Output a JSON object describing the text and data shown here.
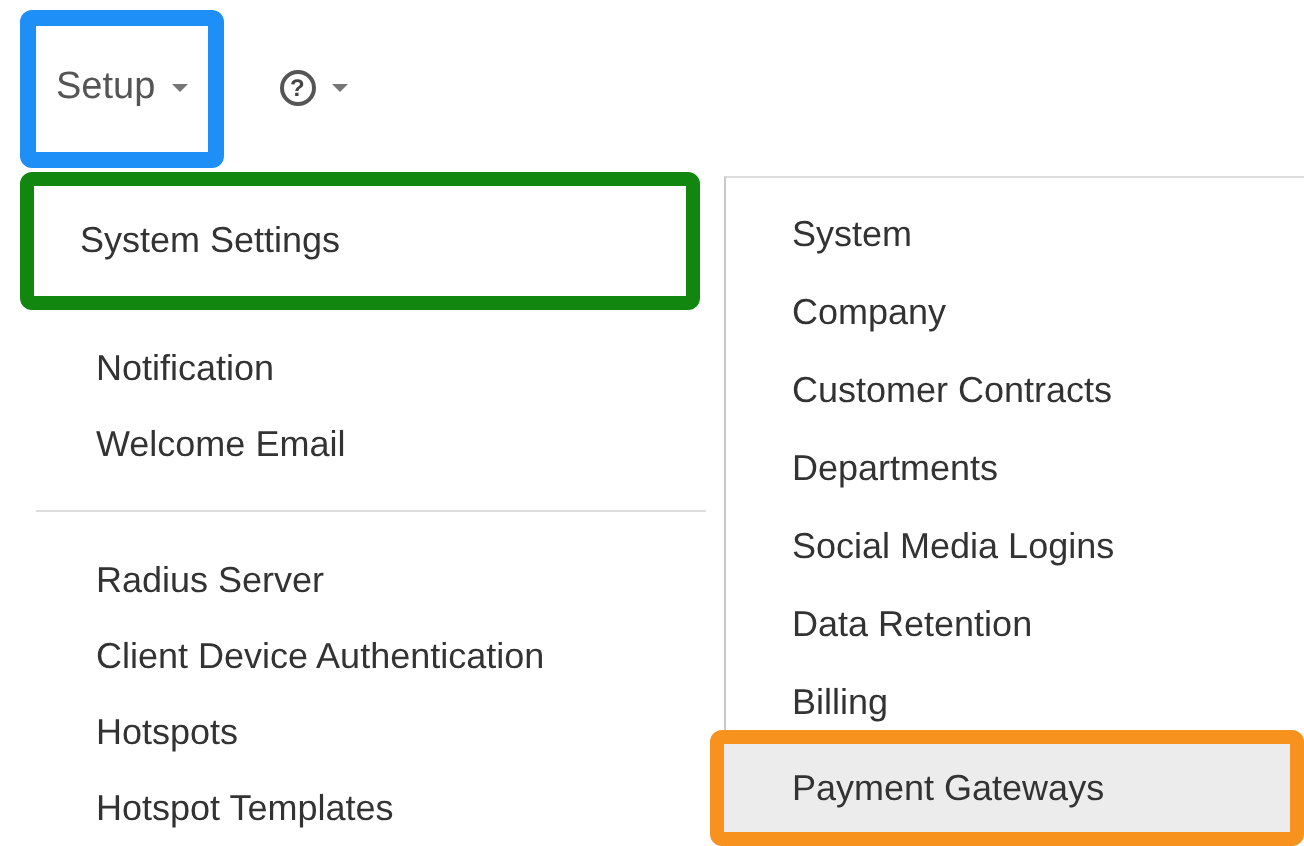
{
  "menu_bar": [
    {
      "kind": "text",
      "label": "Setup",
      "color": "#1e8ff7"
    },
    {
      "kind": "help",
      "label": "?"
    }
  ],
  "menu": {
    "items": [
      {
        "kind": "item",
        "label": "System Settings",
        "color": "#12870f"
      },
      {
        "kind": "spacer"
      },
      {
        "kind": "item",
        "label": "Notification"
      },
      {
        "kind": "item",
        "label": "Welcome Email"
      },
      {
        "kind": "divider"
      },
      {
        "kind": "item",
        "label": "Radius Server"
      },
      {
        "kind": "item",
        "label": "Client Device Authentication"
      },
      {
        "kind": "item",
        "label": "Hotspots"
      },
      {
        "kind": "item",
        "label": "Hotspot Templates"
      }
    ]
  },
  "submenu": {
    "items": [
      {
        "label": "System",
        "selected": false
      },
      {
        "label": "Company",
        "selected": false
      },
      {
        "label": "Customer Contracts",
        "selected": false
      },
      {
        "label": "Departments",
        "selected": false
      },
      {
        "label": "Social Media Logins",
        "selected": false
      },
      {
        "label": "Data Retention",
        "selected": false
      },
      {
        "label": "Billing",
        "selected": false
      },
      {
        "label": "Payment Gateways",
        "selected": true,
        "color": "#f7921e"
      }
    ]
  }
}
